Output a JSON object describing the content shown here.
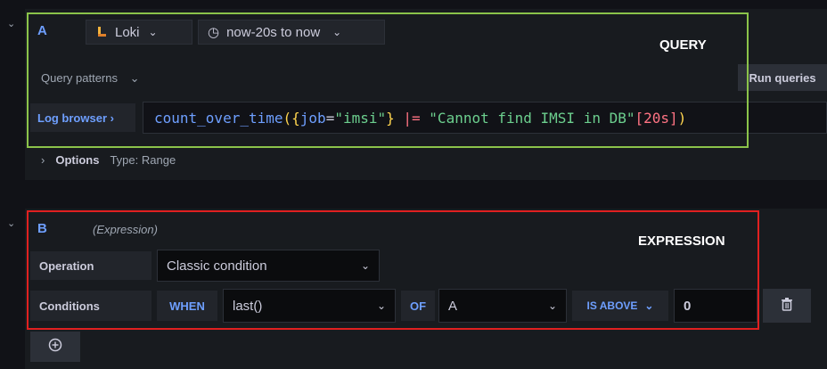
{
  "queryA": {
    "ref_id": "A",
    "datasource": "Loki",
    "time_range": "now-20s to now",
    "query_patterns_label": "Query patterns",
    "run_queries_label": "Run queries",
    "log_browser_label": "Log browser ›",
    "query_parts": {
      "fn": "count_over_time",
      "p1": "(",
      "b1": "{",
      "lbl": "job",
      "eq": "=",
      "val": "\"imsi\"",
      "b2": "}",
      "op": " |= ",
      "str": "\"Cannot find IMSI in DB\"",
      "range": "[20s]",
      "p2": ")"
    },
    "options_label": "Options",
    "options_type": "Type: Range"
  },
  "exprB": {
    "ref_id": "B",
    "type_label": "(Expression)",
    "operation_label": "Operation",
    "operation_value": "Classic condition",
    "conditions_label": "Conditions",
    "when_label": "WHEN",
    "reducer": "last()",
    "of_label": "OF",
    "query_ref": "A",
    "evaluator": "IS ABOVE",
    "threshold": "0"
  },
  "annotations": {
    "query": "QUERY",
    "expression": "EXPRESSION"
  },
  "colors": {
    "query_frame": "#8bc34a",
    "expression_frame": "#e02020",
    "ref_id": "#6e9fff",
    "code_fn": "#6e9fff",
    "code_string": "#6ccf8e",
    "code_bracket": "#ffd54f",
    "code_op": "#ff7383"
  },
  "icons": [
    "chevron-down-icon",
    "loki-icon",
    "clock-icon",
    "chevron-right-icon",
    "trash-icon",
    "add-icon"
  ]
}
